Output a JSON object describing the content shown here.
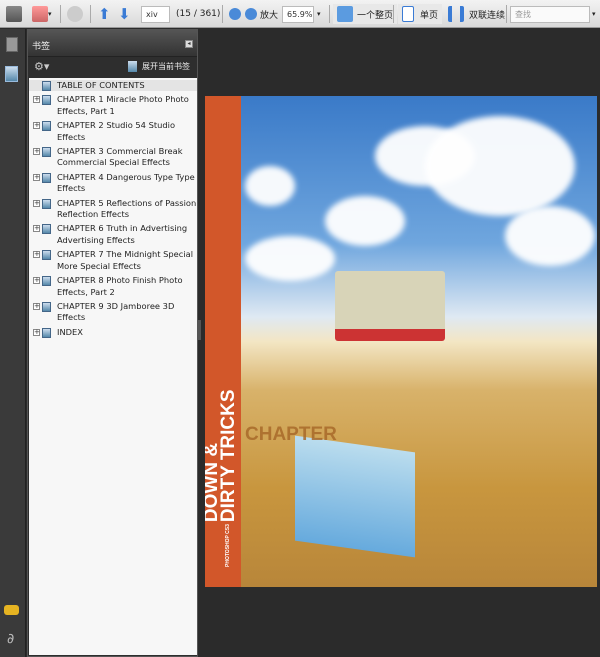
{
  "toolbar": {
    "page_input": "xiv",
    "page_count": "(15 / 361)",
    "zoom_in_label": "放大",
    "zoom_value": "65.9%",
    "fit_page_label": "一个整页",
    "single_page_label": "单页",
    "two_up_label": "双联连续",
    "search_placeholder": "查找"
  },
  "panel": {
    "title": "书签",
    "expand_label": "展开当前书签",
    "bookmarks": [
      {
        "label": "TABLE OF CONTENTS",
        "expandable": false
      },
      {
        "label": "CHAPTER 1 Miracle Photo Photo Effects, Part 1",
        "expandable": true
      },
      {
        "label": "CHAPTER 2 Studio 54 Studio Effects",
        "expandable": true
      },
      {
        "label": "CHAPTER 3 Commercial Break Commercial Special Effects",
        "expandable": true
      },
      {
        "label": "CHAPTER 4 Dangerous Type Type Effects",
        "expandable": true
      },
      {
        "label": "CHAPTER 5 Reflections of Passion Reflection Effects",
        "expandable": true
      },
      {
        "label": "CHAPTER 6 Truth in Advertising Advertising Effects",
        "expandable": true
      },
      {
        "label": "CHAPTER 7 The Midnight Special More Special Effects",
        "expandable": true
      },
      {
        "label": "CHAPTER 8 Photo Finish Photo Effects, Part 2",
        "expandable": true
      },
      {
        "label": "CHAPTER 9 3D Jamboree 3D Effects",
        "expandable": true
      },
      {
        "label": "INDEX",
        "expandable": true
      }
    ]
  },
  "cover": {
    "series": "PHOTOSHOP CS3",
    "title_line1": "DOWN &",
    "title_line2": "DIRTY TRICKS",
    "overlay": "CHAPTER",
    "accent": "#d2572a"
  }
}
